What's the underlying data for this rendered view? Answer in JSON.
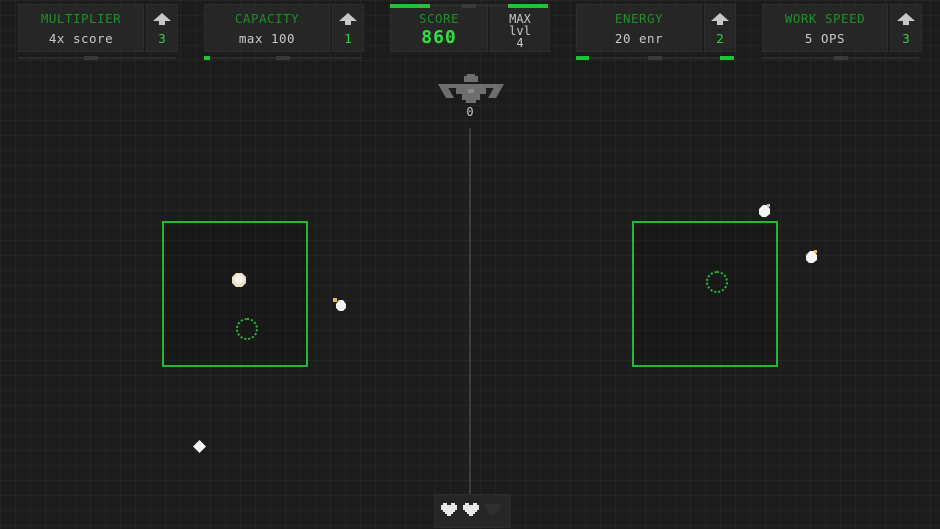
{
  "hud": {
    "multiplier": {
      "title": "MULTIPLIER",
      "value": "4x score",
      "level": "3",
      "progress": 0.0
    },
    "capacity": {
      "title": "CAPACITY",
      "value": "max 100",
      "level": "1",
      "progress": 0.04
    },
    "energy": {
      "title": "ENERGY",
      "value": "20 enr",
      "level": "2",
      "progress": 0.08
    },
    "work_speed": {
      "title": "WORK SPEED",
      "value": "5 OPS",
      "level": "3",
      "progress": 0.0
    },
    "score": {
      "title": "SCORE",
      "value": "860",
      "max_label": "MAX",
      "max_line2": "lvl",
      "max_line3": "4",
      "progress": 0.5
    }
  },
  "turret": {
    "count": "0"
  },
  "lives": {
    "total": 3,
    "remaining": 2
  },
  "colors": {
    "accent_green": "#22c232",
    "title_green": "#1f8f2a",
    "background": "#1c1c1c"
  }
}
